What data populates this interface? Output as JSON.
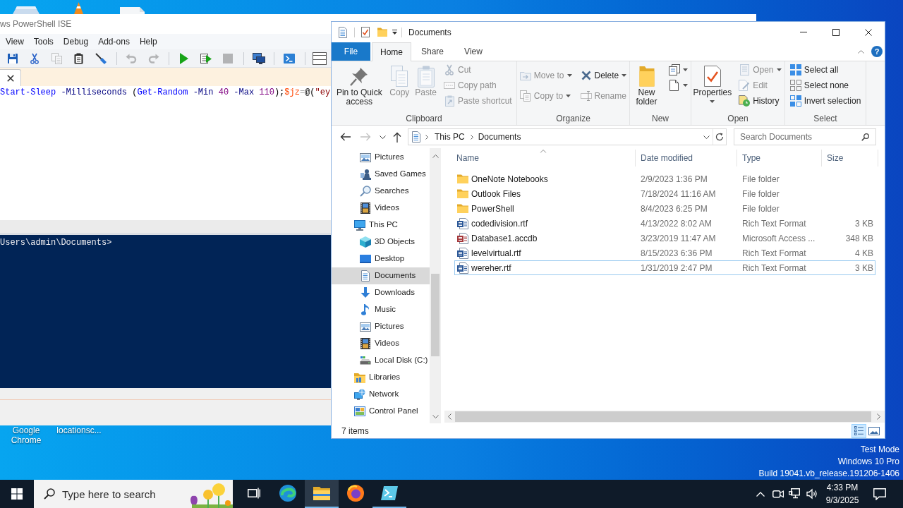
{
  "desktop": {
    "icon_labels": [
      "Google Chrome",
      "locationsc..."
    ],
    "edition_lines": [
      "Test Mode",
      "Windows 10 Pro",
      "Build 19041.vb_release.191206-1406"
    ]
  },
  "ise_window": {
    "title": "ws PowerShell ISE",
    "menu": [
      "View",
      "Tools",
      "Debug",
      "Add-ons",
      "Help"
    ],
    "toolbar": [
      [
        {
          "kind": "save",
          "disabled": false
        },
        {
          "kind": "cut",
          "disabled": false
        },
        {
          "kind": "copy",
          "disabled": true
        },
        {
          "kind": "paste",
          "disabled": false
        },
        {
          "kind": "clear",
          "disabled": false
        }
      ],
      [
        {
          "kind": "undo",
          "disabled": true
        },
        {
          "kind": "redo",
          "disabled": true
        }
      ],
      [
        {
          "kind": "run",
          "disabled": false
        },
        {
          "kind": "run_selection",
          "disabled": false
        },
        {
          "kind": "stop",
          "disabled": true
        }
      ],
      [
        {
          "kind": "remote",
          "disabled": false
        }
      ],
      [
        {
          "kind": "powershell",
          "disabled": false
        }
      ],
      [
        {
          "kind": "layout",
          "disabled": false
        }
      ]
    ],
    "script_line": [
      {
        "text": "Start-Sleep",
        "kind": "command"
      },
      {
        "text": " -Milliseconds",
        "kind": "parameter"
      },
      {
        "text": " (",
        "kind": "group"
      },
      {
        "text": "Get-Random",
        "kind": "command"
      },
      {
        "text": " -Min",
        "kind": "parameter"
      },
      {
        "text": " 40",
        "kind": "number"
      },
      {
        "text": " -Max",
        "kind": "parameter"
      },
      {
        "text": " 110",
        "kind": "number"
      },
      {
        "text": ");",
        "kind": "group"
      },
      {
        "text": "$jz",
        "kind": "variable"
      },
      {
        "text": "=",
        "kind": "operator"
      },
      {
        "text": "@(",
        "kind": "group"
      },
      {
        "text": "\"ey",
        "kind": "string"
      }
    ],
    "console_prompt": "Users\\admin\\Documents>"
  },
  "explorer": {
    "title": "Documents",
    "ribbon_tabs": [
      {
        "label": "File",
        "kind": "file_menu",
        "selected": false
      },
      {
        "label": "Home",
        "kind": "tab",
        "selected": true
      },
      {
        "label": "Share",
        "kind": "tab",
        "selected": false
      },
      {
        "label": "View",
        "kind": "tab",
        "selected": false
      }
    ],
    "help": "?",
    "ribbon_groups": [
      {
        "label": "Clipboard",
        "columns": [
          {
            "kind": "large",
            "items": [
              {
                "kind": "pin",
                "label": "Pin to Quick access",
                "disabled": false
              }
            ]
          },
          {
            "kind": "large",
            "items": [
              {
                "kind": "copy",
                "label": "Copy",
                "disabled": true
              }
            ]
          },
          {
            "kind": "large",
            "items": [
              {
                "kind": "paste",
                "label": "Paste",
                "disabled": true
              }
            ]
          },
          {
            "kind": "small",
            "items": [
              {
                "kind": "cut",
                "label": "Cut",
                "disabled": true
              },
              {
                "kind": "copy_path",
                "label": "Copy path",
                "disabled": true
              },
              {
                "kind": "paste_shortcut",
                "label": "Paste shortcut",
                "disabled": true
              }
            ]
          }
        ]
      },
      {
        "label": "Organize",
        "columns": [
          {
            "kind": "small",
            "items": [
              {
                "kind": "move_to",
                "label": "Move to",
                "disabled": true,
                "dropdown": true
              },
              {
                "kind": "copy_to",
                "label": "Copy to",
                "disabled": true,
                "dropdown": true
              }
            ]
          },
          {
            "kind": "small",
            "items": [
              {
                "kind": "delete",
                "label": "Delete",
                "disabled": false,
                "dropdown": true
              },
              {
                "kind": "rename",
                "label": "Rename",
                "disabled": true
              }
            ]
          }
        ]
      },
      {
        "label": "New",
        "columns": [
          {
            "kind": "large",
            "items": [
              {
                "kind": "new_folder",
                "label": "New folder",
                "disabled": false
              }
            ]
          },
          {
            "kind": "small",
            "items": [
              {
                "kind": "new_item",
                "disabled": false,
                "dropdown": true
              },
              {
                "kind": "easy_access",
                "disabled": false,
                "dropdown": true
              }
            ]
          }
        ]
      },
      {
        "label": "Open",
        "columns": [
          {
            "kind": "large",
            "items": [
              {
                "kind": "properties",
                "label": "Properties",
                "disabled": false,
                "dropdown": true
              }
            ]
          },
          {
            "kind": "small",
            "items": [
              {
                "kind": "open",
                "label": "Open",
                "disabled": true,
                "dropdown": true
              },
              {
                "kind": "edit",
                "label": "Edit",
                "disabled": true
              },
              {
                "kind": "history",
                "label": "History",
                "disabled": false
              }
            ]
          }
        ]
      },
      {
        "label": "Select",
        "columns": [
          {
            "kind": "small",
            "items": [
              {
                "kind": "select_all",
                "label": "Select all",
                "disabled": false
              },
              {
                "kind": "select_none",
                "label": "Select none",
                "disabled": false
              },
              {
                "kind": "invert_selection",
                "label": "Invert selection",
                "disabled": false
              }
            ]
          }
        ]
      }
    ],
    "nav_buttons": [
      {
        "kind": "back",
        "disabled": false
      },
      {
        "kind": "forward",
        "disabled": true
      },
      {
        "kind": "recent",
        "disabled": false
      },
      {
        "kind": "up",
        "disabled": false
      }
    ],
    "address": {
      "path": [
        "This PC",
        "Documents"
      ]
    },
    "search": {
      "placeholder": "Search Documents"
    },
    "nav_pane": {
      "continued_children": [
        {
          "label": "Pictures",
          "kind": "pictures",
          "selected": false
        },
        {
          "label": "Saved Games",
          "kind": "games",
          "selected": false
        },
        {
          "label": "Searches",
          "kind": "search",
          "selected": false
        },
        {
          "label": "Videos",
          "kind": "videos",
          "selected": false
        }
      ],
      "items": [
        {
          "label": "This PC",
          "kind": "pc",
          "selected": false,
          "children": [
            {
              "label": "3D Objects",
              "kind": "objects3d",
              "selected": false
            },
            {
              "label": "Desktop",
              "kind": "desktop",
              "selected": false
            },
            {
              "label": "Documents",
              "kind": "documents",
              "selected": true
            },
            {
              "label": "Downloads",
              "kind": "downloads",
              "selected": false
            },
            {
              "label": "Music",
              "kind": "music",
              "selected": false
            },
            {
              "label": "Pictures",
              "kind": "pictures",
              "selected": false
            },
            {
              "label": "Videos",
              "kind": "videos",
              "selected": false
            },
            {
              "label": "Local Disk (C:)",
              "kind": "drive",
              "selected": false
            }
          ]
        },
        {
          "label": "Libraries",
          "kind": "libraries",
          "selected": false
        },
        {
          "label": "Network",
          "kind": "network",
          "selected": false
        },
        {
          "label": "Control Panel",
          "kind": "controlpanel",
          "selected": false
        }
      ]
    },
    "file_list": {
      "columns": [
        {
          "label": "Name",
          "sorted": true
        },
        {
          "label": "Date modified",
          "sorted": false
        },
        {
          "label": "Type",
          "sorted": false
        },
        {
          "label": "Size",
          "sorted": false
        }
      ],
      "rows": [
        {
          "kind": "folder",
          "name": "OneNote Notebooks",
          "date": "2/9/2023 1:36 PM",
          "type": "File folder",
          "selected": false,
          "focused": false
        },
        {
          "kind": "folder",
          "name": "Outlook Files",
          "date": "7/18/2024 11:16 AM",
          "type": "File folder",
          "selected": false,
          "focused": false
        },
        {
          "kind": "folder",
          "name": "PowerShell",
          "date": "8/4/2023 6:25 PM",
          "type": "File folder",
          "selected": false,
          "focused": false
        },
        {
          "kind": "rtf",
          "name": "codedivision.rtf",
          "date": "4/13/2022 8:02 AM",
          "type": "Rich Text Format",
          "size": "3 KB",
          "selected": false,
          "focused": false
        },
        {
          "kind": "access",
          "name": "Database1.accdb",
          "date": "3/23/2019 11:47 AM",
          "type": "Microsoft Access ...",
          "size": "348 KB",
          "selected": false,
          "focused": false
        },
        {
          "kind": "rtf",
          "name": "levelvirtual.rtf",
          "date": "8/15/2023 6:36 PM",
          "type": "Rich Text Format",
          "size": "4 KB",
          "selected": false,
          "focused": false
        },
        {
          "kind": "rtf",
          "name": "wereher.rtf",
          "date": "1/31/2019 2:47 PM",
          "type": "Rich Text Format",
          "size": "3 KB",
          "selected": false,
          "focused": true
        }
      ]
    },
    "status": {
      "item_count": "7 items",
      "views": [
        {
          "kind": "details",
          "selected": true
        },
        {
          "kind": "large_icons",
          "selected": false
        }
      ]
    }
  },
  "taskbar": {
    "search": {
      "placeholder": "Type here to search"
    },
    "apps": [
      {
        "kind": "task_view",
        "running": false,
        "active": false
      },
      {
        "kind": "edge",
        "running": false,
        "active": false
      },
      {
        "kind": "explorer",
        "running": true,
        "active": true
      },
      {
        "kind": "firefox",
        "running": false,
        "active": false
      },
      {
        "kind": "powershell_ise",
        "running": true,
        "active": false
      }
    ],
    "clock": {
      "time": "4:33 PM",
      "date": "9/3/2025"
    }
  }
}
